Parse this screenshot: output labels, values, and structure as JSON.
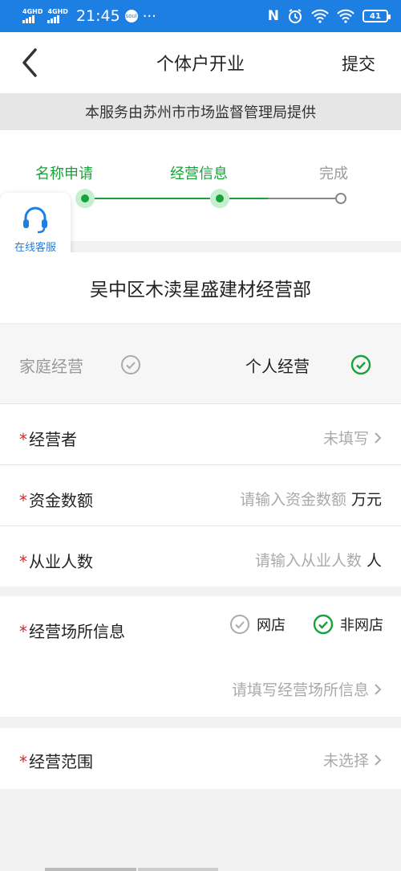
{
  "status_bar": {
    "signal1": "4GHD",
    "signal2": "4GHD",
    "time": "21:45",
    "notif_badge": "soul",
    "more": "···",
    "nfc": "N",
    "battery": "41"
  },
  "header": {
    "title": "个体户开业",
    "submit_label": "提交"
  },
  "provider_text": "本服务由苏州市市场监督管理局提供",
  "steps": [
    {
      "label": "名称申请",
      "state": "done"
    },
    {
      "label": "经营信息",
      "state": "current"
    },
    {
      "label": "完成",
      "state": "pending"
    }
  ],
  "customer_service": {
    "label": "在线客服",
    "icon": "headset-icon"
  },
  "company_name": "吴中区木渎星盛建材经营部",
  "business_type": {
    "options": [
      {
        "label": "家庭经营",
        "selected": false
      },
      {
        "label": "个人经营",
        "selected": true
      }
    ]
  },
  "form": {
    "operator": {
      "label": "经营者",
      "value": "未填写"
    },
    "capital": {
      "label": "资金数额",
      "placeholder": "请输入资金数额",
      "unit": "万元"
    },
    "employees": {
      "label": "从业人数",
      "placeholder": "请输入从业人数",
      "unit": "人"
    },
    "premises": {
      "label": "经营场所信息",
      "option_online": "网店",
      "option_offline": "非网店",
      "placeholder": "请填写经营场所信息"
    },
    "scope": {
      "label": "经营范围",
      "value": "未选择"
    }
  },
  "colors": {
    "status_bar": "#1e7fe3",
    "accent_green": "#19a23a",
    "required": "#d12a2a"
  }
}
